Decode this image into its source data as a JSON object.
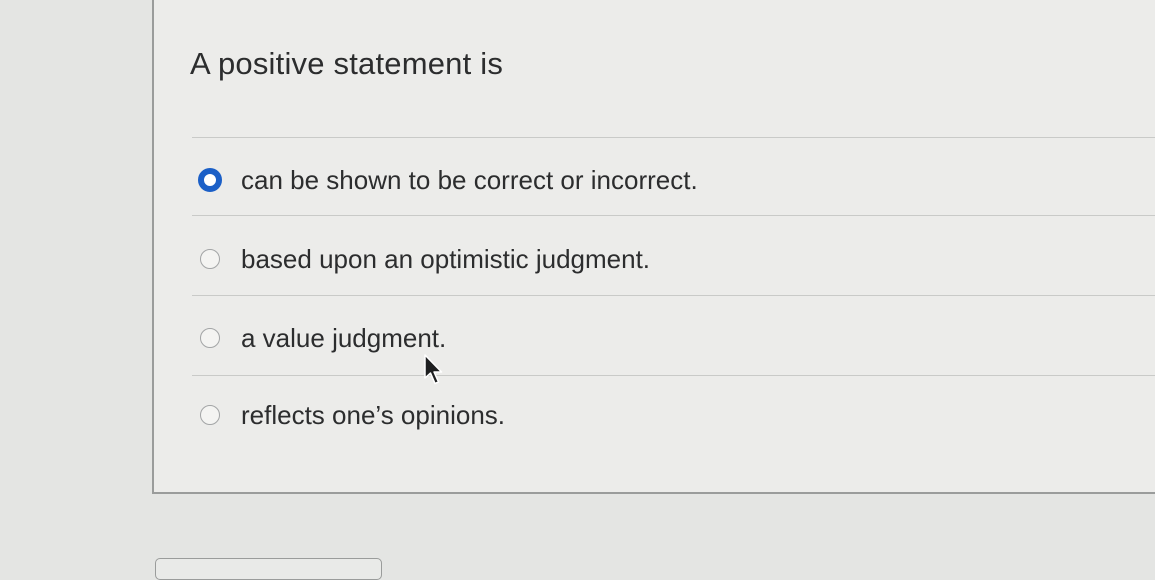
{
  "question": {
    "text": "A positive statement is"
  },
  "options": [
    {
      "label": "can be shown to be correct or incorrect.",
      "selected": true
    },
    {
      "label": "based upon an optimistic judgment.",
      "selected": false
    },
    {
      "label": "a value judgment.",
      "selected": false
    },
    {
      "label": "reflects one’s opinions.",
      "selected": false
    }
  ],
  "colors": {
    "selected_radio": "#1b5fc7",
    "text": "#2c2d2e",
    "background": "#ececea"
  },
  "icons": {
    "pointer": "mouse-pointer-icon"
  }
}
